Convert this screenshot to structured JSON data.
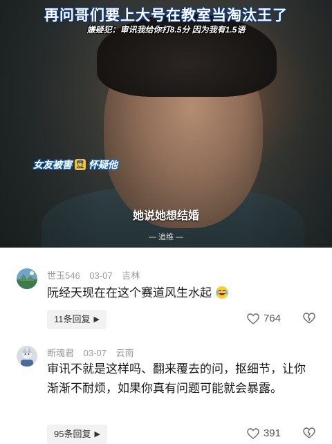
{
  "video": {
    "title": "再问哥们要上大号在教室当淘汰王了",
    "subtitle": "嫌疑犯：审讯我给你打8.5分 因为我有1.5语",
    "tag_text": "女友被害",
    "tag_suffix": "怀疑他",
    "caption": "她说她想结婚",
    "watermark": "— 追维 —"
  },
  "comments": [
    {
      "user": "世玉546",
      "date": "03-07",
      "location": "吉林",
      "text": "阮经天现在在这个赛道风生水起",
      "emoji": "laughing-crying-emoji",
      "replies_label": "11条回复",
      "likes": "764"
    },
    {
      "user": "断魂君",
      "date": "03-07",
      "location": "云南",
      "text": "审讯不就是这样吗、翻来覆去的问，抠细节，让你渐渐不耐烦，如果你真有问题可能就会暴露。",
      "replies_label": "95条回复",
      "likes": "391"
    }
  ],
  "colors": {
    "title_outline": "#0a3a8a",
    "meta_gray": "#9a9a9a",
    "reply_bg": "#f2f2f2"
  }
}
